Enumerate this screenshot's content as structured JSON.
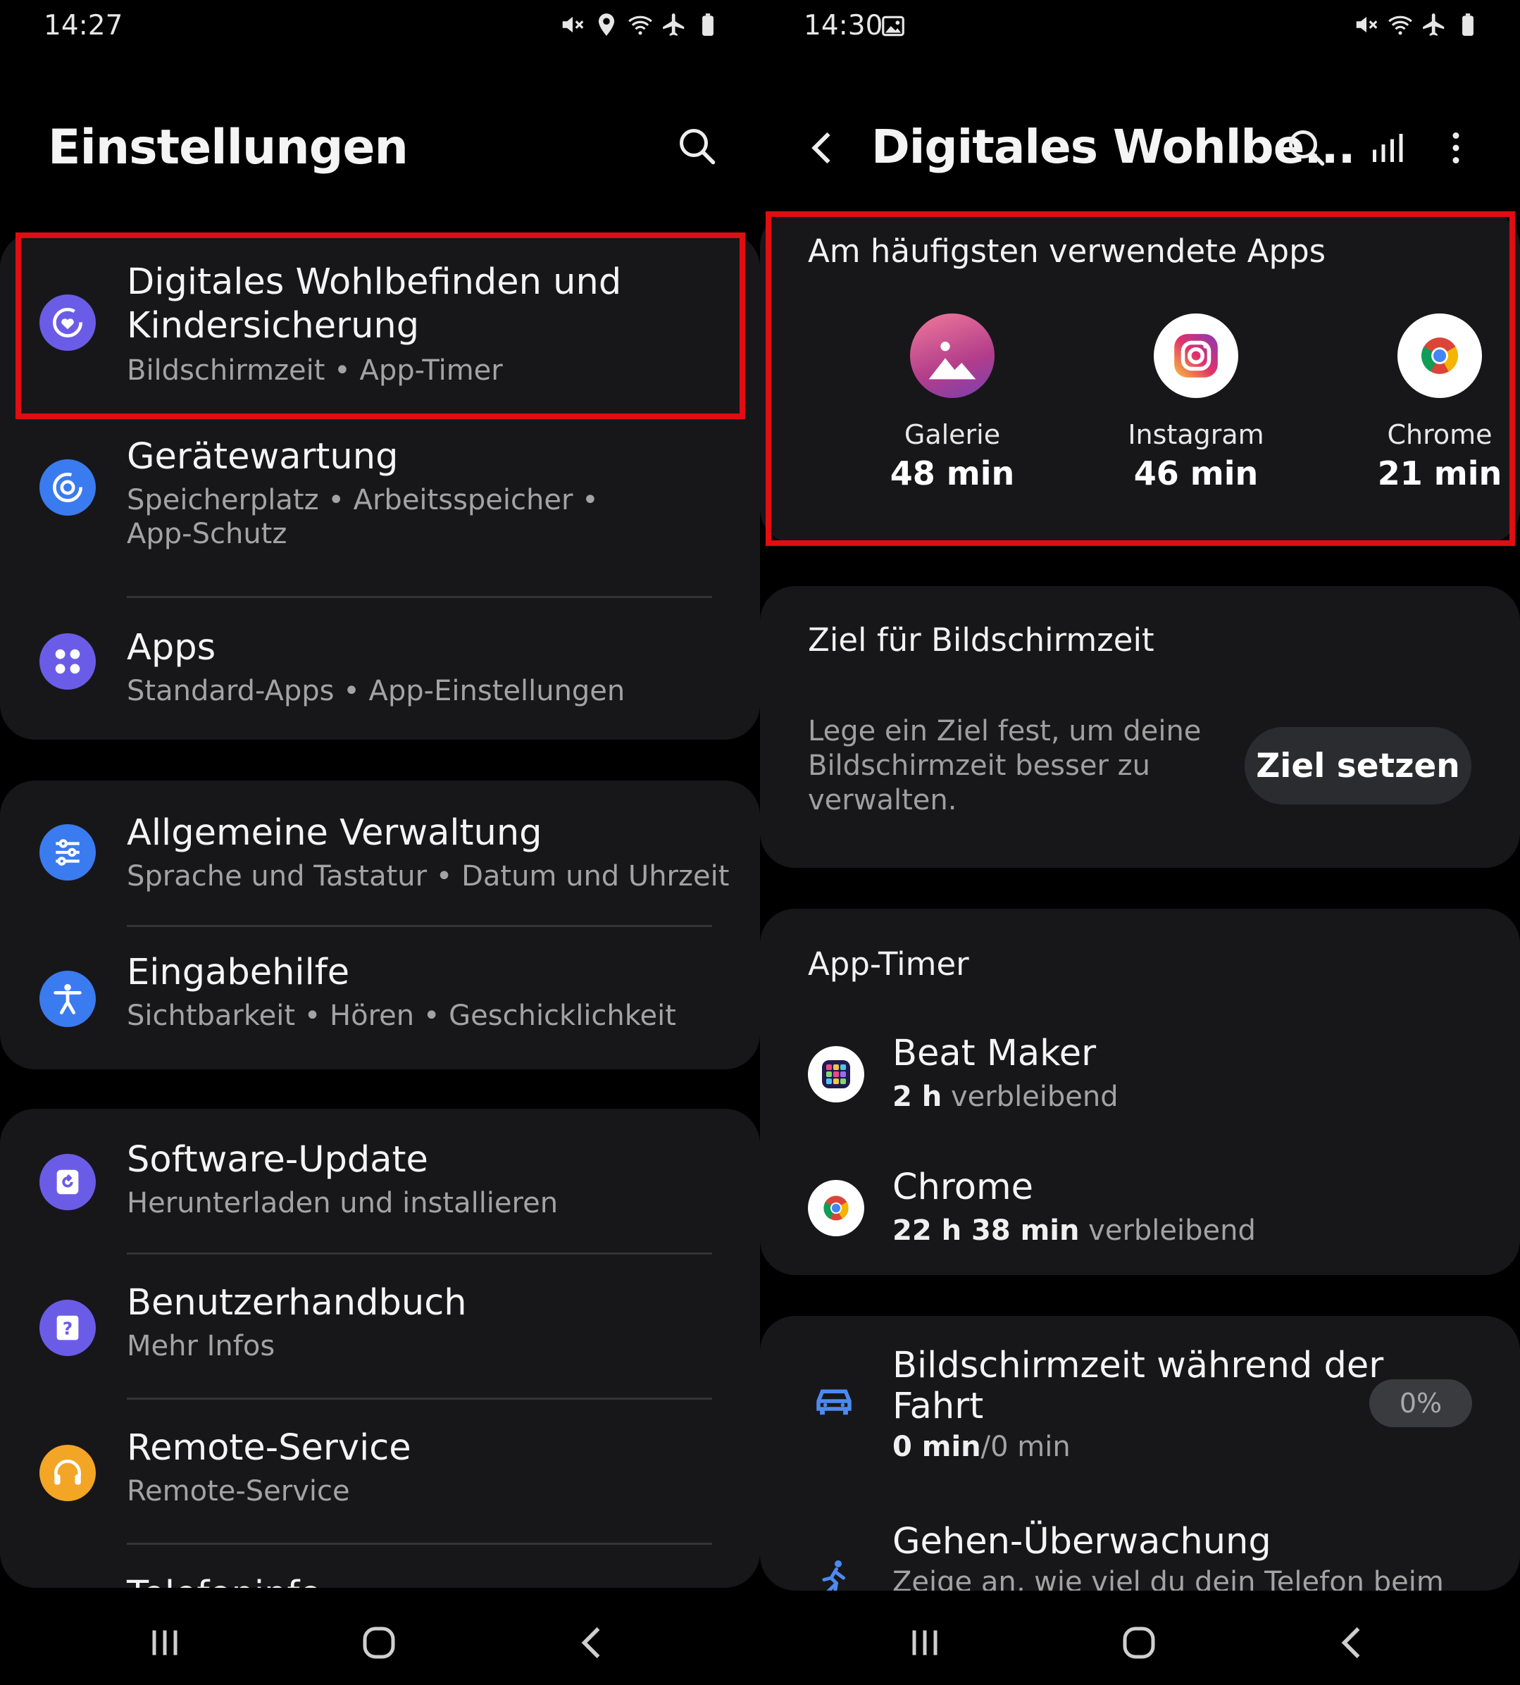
{
  "left": {
    "status_time": "14:27",
    "title": "Einstellungen",
    "items": [
      {
        "title": "Digitales Wohlbefinden und Kindersicherung",
        "title_l1": "Digitales Wohlbefinden und",
        "title_l2": "Kindersicherung",
        "sub": "Bildschirmzeit  •  App-Timer"
      },
      {
        "title": "Gerätewartung",
        "sub_l1": "Speicherplatz  •  Arbeitsspeicher  •",
        "sub_l2": "App-Schutz"
      },
      {
        "title": "Apps",
        "sub": "Standard-Apps  •  App-Einstellungen"
      },
      {
        "title": "Allgemeine Verwaltung",
        "sub": "Sprache und Tastatur  •  Datum und Uhrzeit"
      },
      {
        "title": "Eingabehilfe",
        "sub": "Sichtbarkeit  •  Hören  •  Geschicklichkeit"
      },
      {
        "title": "Software-Update",
        "sub": "Herunterladen und installieren"
      },
      {
        "title": "Benutzerhandbuch",
        "sub": "Mehr Infos"
      },
      {
        "title": "Remote-Service",
        "sub": "Remote-Service"
      },
      {
        "title": "Telefoninfo"
      }
    ]
  },
  "right": {
    "status_time": "14:30",
    "title": "Digitales Wohlbe...",
    "most_used": {
      "title": "Am häufigsten verwendete Apps",
      "apps": [
        {
          "name": "Galerie",
          "time": "48 min"
        },
        {
          "name": "Instagram",
          "time": "46 min"
        },
        {
          "name": "Chrome",
          "time": "21 min"
        }
      ]
    },
    "goal": {
      "title": "Ziel für Bildschirmzeit",
      "desc_l1": "Lege ein Ziel fest, um deine",
      "desc_l2": "Bildschirmzeit besser zu",
      "desc_l3": "verwalten.",
      "button": "Ziel setzen"
    },
    "app_timer": {
      "title": "App-Timer",
      "items": [
        {
          "name": "Beat Maker",
          "time": "2 h",
          "suffix": " verbleibend"
        },
        {
          "name": "Chrome",
          "time": "22 h 38 min",
          "suffix": " verbleibend"
        }
      ]
    },
    "driving": {
      "title_l1": "Bildschirmzeit während der",
      "title_l2": "Fahrt",
      "value": "0 min",
      "total": "/0 min",
      "badge": "0%"
    },
    "walking": {
      "title": "Gehen-Überwachung",
      "sub": "Zeige an, wie viel du dein Telefon beim"
    }
  },
  "colors": {
    "highlight": "#e00d12",
    "card": "#171719",
    "accent_purple": "#6b5ce7",
    "accent_blue": "#3a7bf0"
  }
}
